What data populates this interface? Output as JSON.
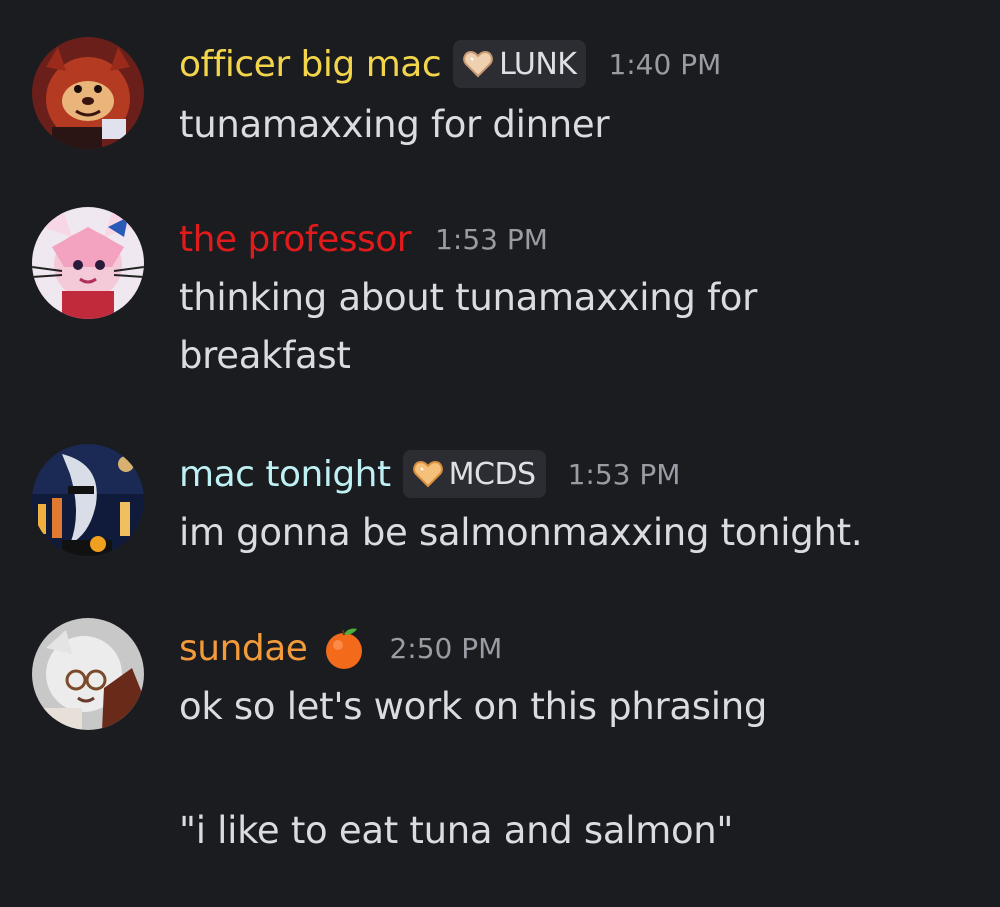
{
  "colors": {
    "background": "#1b1c20",
    "officer_name": "#f2d54b",
    "professor_name": "#e11b1b",
    "mac_name": "#bff0f3",
    "sundae_name": "#f39a3a",
    "text": "#dbdce0",
    "timestamp": "#9a9ba3",
    "tag_bg": "#2c2d33"
  },
  "messages": [
    {
      "username": "officer big mac",
      "tag": "LUNK",
      "tag_icon": "heart-icon",
      "time": "1:40 PM",
      "lines": [
        "tunamaxxing for dinner"
      ]
    },
    {
      "username": "the professor",
      "time": "1:53 PM",
      "lines": [
        "thinking about tunamaxxing for",
        "breakfast"
      ]
    },
    {
      "username": "mac tonight",
      "tag": "MCDS",
      "tag_icon": "heart-icon",
      "time": "1:53 PM",
      "lines": [
        "im gonna be salmonmaxxing tonight."
      ]
    },
    {
      "username": "sundae",
      "name_emoji": "tangerine-icon",
      "time": "2:50 PM",
      "lines": [
        "ok so let's work on this phrasing",
        "\"i like to eat tuna and salmon\""
      ]
    }
  ]
}
